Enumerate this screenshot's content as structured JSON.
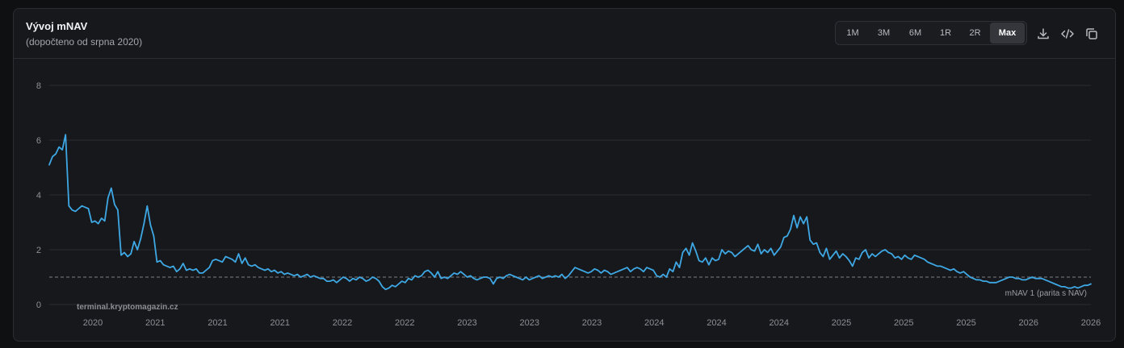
{
  "header": {
    "title": "Vývoj mNAV",
    "subtitle": "(dopočteno od srpna 2020)"
  },
  "range_buttons": [
    {
      "label": "1M",
      "active": false
    },
    {
      "label": "3M",
      "active": false
    },
    {
      "label": "6M",
      "active": false
    },
    {
      "label": "1R",
      "active": false
    },
    {
      "label": "2R",
      "active": false
    },
    {
      "label": "Max",
      "active": true
    }
  ],
  "toolbar_icons": [
    "download-icon",
    "code-icon",
    "copy-icon"
  ],
  "watermark": "terminal.kryptomagazin.cz",
  "colors": {
    "line": "#3ea8e5",
    "grid": "#2a2c31",
    "reference": "#6a6c72",
    "background": "#17181b"
  },
  "chart_data": {
    "type": "line",
    "title": "",
    "xlabel": "",
    "ylabel": "",
    "ylim": [
      0,
      8
    ],
    "y_ticks": [
      0,
      2,
      4,
      6,
      8
    ],
    "x_ticks": [
      "2020",
      "2021",
      "2021",
      "2021",
      "2022",
      "2022",
      "2023",
      "2023",
      "2023",
      "2024",
      "2024",
      "2024",
      "2025",
      "2025",
      "2025",
      "2026",
      "2026"
    ],
    "grid": true,
    "reference_line": {
      "y": 1,
      "label": "mNAV 1 (parita s NAV)"
    },
    "series": [
      {
        "values": [
          5.1,
          5.4,
          5.5,
          5.75,
          5.65,
          6.2,
          3.6,
          3.45,
          3.4,
          3.5,
          3.6,
          3.55,
          3.5,
          3.0,
          3.05,
          2.95,
          3.15,
          3.05,
          3.9,
          4.25,
          3.65,
          3.45,
          1.8,
          1.9,
          1.75,
          1.85,
          2.3,
          2.0,
          2.4,
          2.95,
          3.6,
          2.9,
          2.5,
          1.55,
          1.6,
          1.45,
          1.4,
          1.35,
          1.4,
          1.2,
          1.3,
          1.5,
          1.25,
          1.3,
          1.25,
          1.3,
          1.15,
          1.15,
          1.25,
          1.35,
          1.6,
          1.65,
          1.6,
          1.55,
          1.75,
          1.7,
          1.65,
          1.55,
          1.85,
          1.5,
          1.7,
          1.45,
          1.4,
          1.45,
          1.35,
          1.3,
          1.25,
          1.3,
          1.2,
          1.25,
          1.15,
          1.2,
          1.1,
          1.15,
          1.1,
          1.05,
          1.1,
          1.0,
          1.05,
          1.1,
          1.0,
          1.05,
          1.0,
          0.95,
          0.95,
          0.85,
          0.85,
          0.9,
          0.8,
          0.9,
          1.0,
          0.95,
          0.85,
          0.95,
          0.9,
          1.0,
          0.95,
          0.85,
          0.9,
          1.0,
          0.95,
          0.85,
          0.65,
          0.55,
          0.6,
          0.7,
          0.65,
          0.75,
          0.85,
          0.8,
          0.95,
          0.9,
          1.05,
          1.0,
          1.05,
          1.2,
          1.25,
          1.15,
          1.0,
          1.2,
          0.95,
          1.0,
          0.95,
          1.05,
          1.15,
          1.1,
          1.2,
          1.1,
          1.0,
          1.05,
          0.95,
          0.9,
          0.95,
          1.0,
          1.0,
          0.95,
          0.75,
          0.95,
          1.0,
          0.95,
          1.05,
          1.1,
          1.05,
          1.0,
          0.95,
          0.9,
          1.0,
          0.9,
          0.95,
          1.0,
          1.05,
          0.95,
          1.0,
          1.05,
          1.0,
          1.05,
          1.0,
          1.1,
          0.95,
          1.05,
          1.2,
          1.35,
          1.3,
          1.25,
          1.2,
          1.15,
          1.2,
          1.3,
          1.25,
          1.15,
          1.25,
          1.2,
          1.1,
          1.15,
          1.2,
          1.25,
          1.3,
          1.35,
          1.2,
          1.3,
          1.35,
          1.3,
          1.2,
          1.35,
          1.3,
          1.25,
          1.05,
          1.0,
          1.1,
          1.0,
          1.3,
          1.2,
          1.55,
          1.35,
          1.9,
          2.05,
          1.8,
          2.25,
          1.95,
          1.6,
          1.55,
          1.7,
          1.45,
          1.7,
          1.6,
          1.65,
          2.0,
          1.85,
          1.95,
          1.9,
          1.75,
          1.85,
          1.95,
          2.05,
          2.15,
          2.0,
          1.95,
          2.2,
          1.85,
          2.0,
          1.9,
          2.05,
          1.8,
          1.95,
          2.1,
          2.45,
          2.5,
          2.75,
          3.25,
          2.8,
          3.2,
          2.95,
          3.2,
          2.35,
          2.2,
          2.25,
          1.9,
          1.75,
          2.05,
          1.65,
          1.8,
          1.95,
          1.7,
          1.85,
          1.75,
          1.6,
          1.4,
          1.7,
          1.65,
          1.9,
          2.0,
          1.7,
          1.85,
          1.75,
          1.85,
          1.95,
          2.0,
          1.9,
          1.85,
          1.7,
          1.75,
          1.65,
          1.8,
          1.7,
          1.65,
          1.8,
          1.75,
          1.7,
          1.65,
          1.55,
          1.5,
          1.45,
          1.4,
          1.4,
          1.35,
          1.3,
          1.25,
          1.3,
          1.2,
          1.15,
          1.2,
          1.1,
          1.0,
          0.95,
          0.9,
          0.9,
          0.85,
          0.85,
          0.8,
          0.8,
          0.8,
          0.85,
          0.9,
          0.95,
          1.0,
          1.0,
          0.95,
          0.95,
          0.9,
          0.9,
          0.95,
          1.0,
          0.95,
          0.95,
          0.95,
          0.9,
          0.85,
          0.8,
          0.75,
          0.7,
          0.65,
          0.65,
          0.6,
          0.6,
          0.65,
          0.6,
          0.65,
          0.7,
          0.7,
          0.75
        ]
      }
    ]
  }
}
